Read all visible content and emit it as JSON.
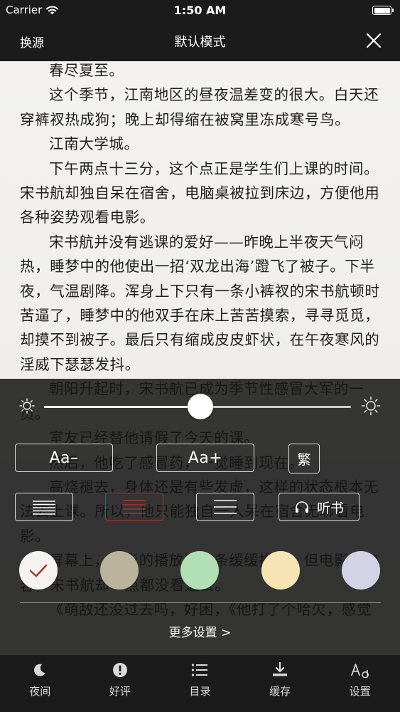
{
  "status_bar": {
    "carrier": "Carrier",
    "time": "1:50 AM"
  },
  "top_nav": {
    "source_label": "换源",
    "title": "默认模式"
  },
  "content": {
    "paragraphs": [
      "春尽夏至。",
      "这个季节，江南地区的昼夜温差变的很大。白天还穿裤衩热成狗；晚上却得缩在被窝里冻成寒号鸟。",
      "江南大学城。",
      "下午两点十三分，这个点正是学生们上课的时间。宋书航却独自呆在宿舍，电脑桌被拉到床边，方便他用各种姿势观看电影。",
      "宋书航并没有逃课的爱好——昨晚上半夜天气闷热，睡梦中的他使出一招‘双龙出海’蹬飞了被子。下半夜，气温剧降。浑身上下只有一条小裤衩的宋书航顿时苦逼了，睡梦中的他双手在床上苦苦摸索，寻寻觅觅，却摸不到被子。最后只有缩成皮皮虾状，在午夜寒风的淫威下瑟瑟发抖。",
      "朝阳升起时，宋书航已成为季节性感冒大军的一员。",
      "室友已经替他请假了今天的课。",
      "然后，他吃了感冒药，一觉睡到现在。",
      "高烧褪去，身体还是有些发虚，这样的状态根本无法去上课。所以，他只能独自一人呆在宿舍无聊看电影。",
      "屏幕上，电影的播放进度条缓缓推进。但电影的内容，宋书航却一点都没看进去。",
      "《萌敌还没过去吗，好困，《他打了个哈欠，感觉"
    ]
  },
  "settings": {
    "brightness": 0.51,
    "font_decrease_label": "Aa–",
    "font_increase_label": "Aa+",
    "traditional_label": "繁",
    "listen_label": "听书",
    "more_settings_label": "更多设置 >",
    "selected_spacing": 1,
    "selected_theme": 0,
    "theme_colors": [
      "#f4f3ef",
      "#bbb39c",
      "#b1e0b5",
      "#f7e4b5",
      "#d4d3e6"
    ],
    "accent_color": "#a2352d"
  },
  "tab_bar": {
    "tabs": [
      {
        "label": "夜间",
        "icon": "moon-icon"
      },
      {
        "label": "好评",
        "icon": "exclamation-circle-icon"
      },
      {
        "label": "目录",
        "icon": "list-icon"
      },
      {
        "label": "缓存",
        "icon": "download-icon"
      },
      {
        "label": "设置",
        "icon": "font-aa-icon"
      }
    ]
  }
}
